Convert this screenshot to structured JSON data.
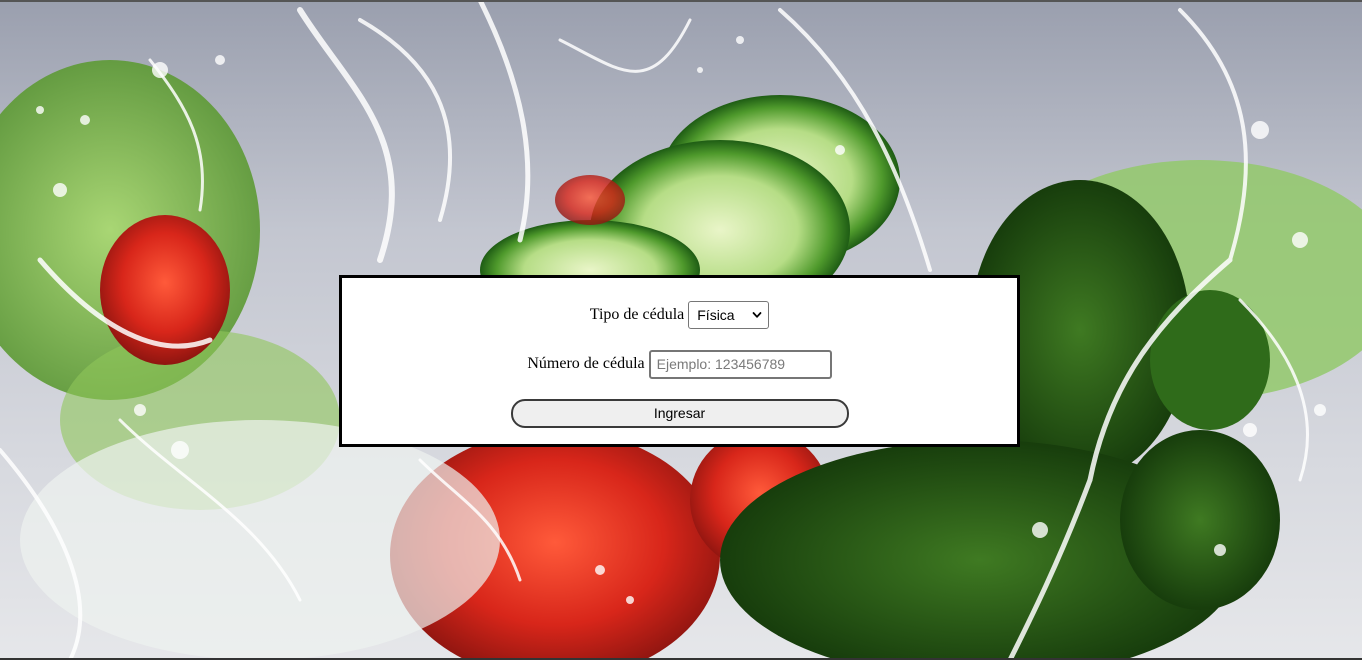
{
  "form": {
    "cedula_type": {
      "label": "Tipo de cédula",
      "selected": "Física"
    },
    "cedula_number": {
      "label": "Número de cédula",
      "value": "",
      "placeholder": "Ejemplo: 123456789"
    },
    "submit_label": "Ingresar"
  },
  "background": {
    "description_icon": "vegetables-water-splash-image"
  },
  "colors": {
    "box_border": "#000000",
    "box_background": "#ffffff",
    "button_background": "#efefef"
  }
}
